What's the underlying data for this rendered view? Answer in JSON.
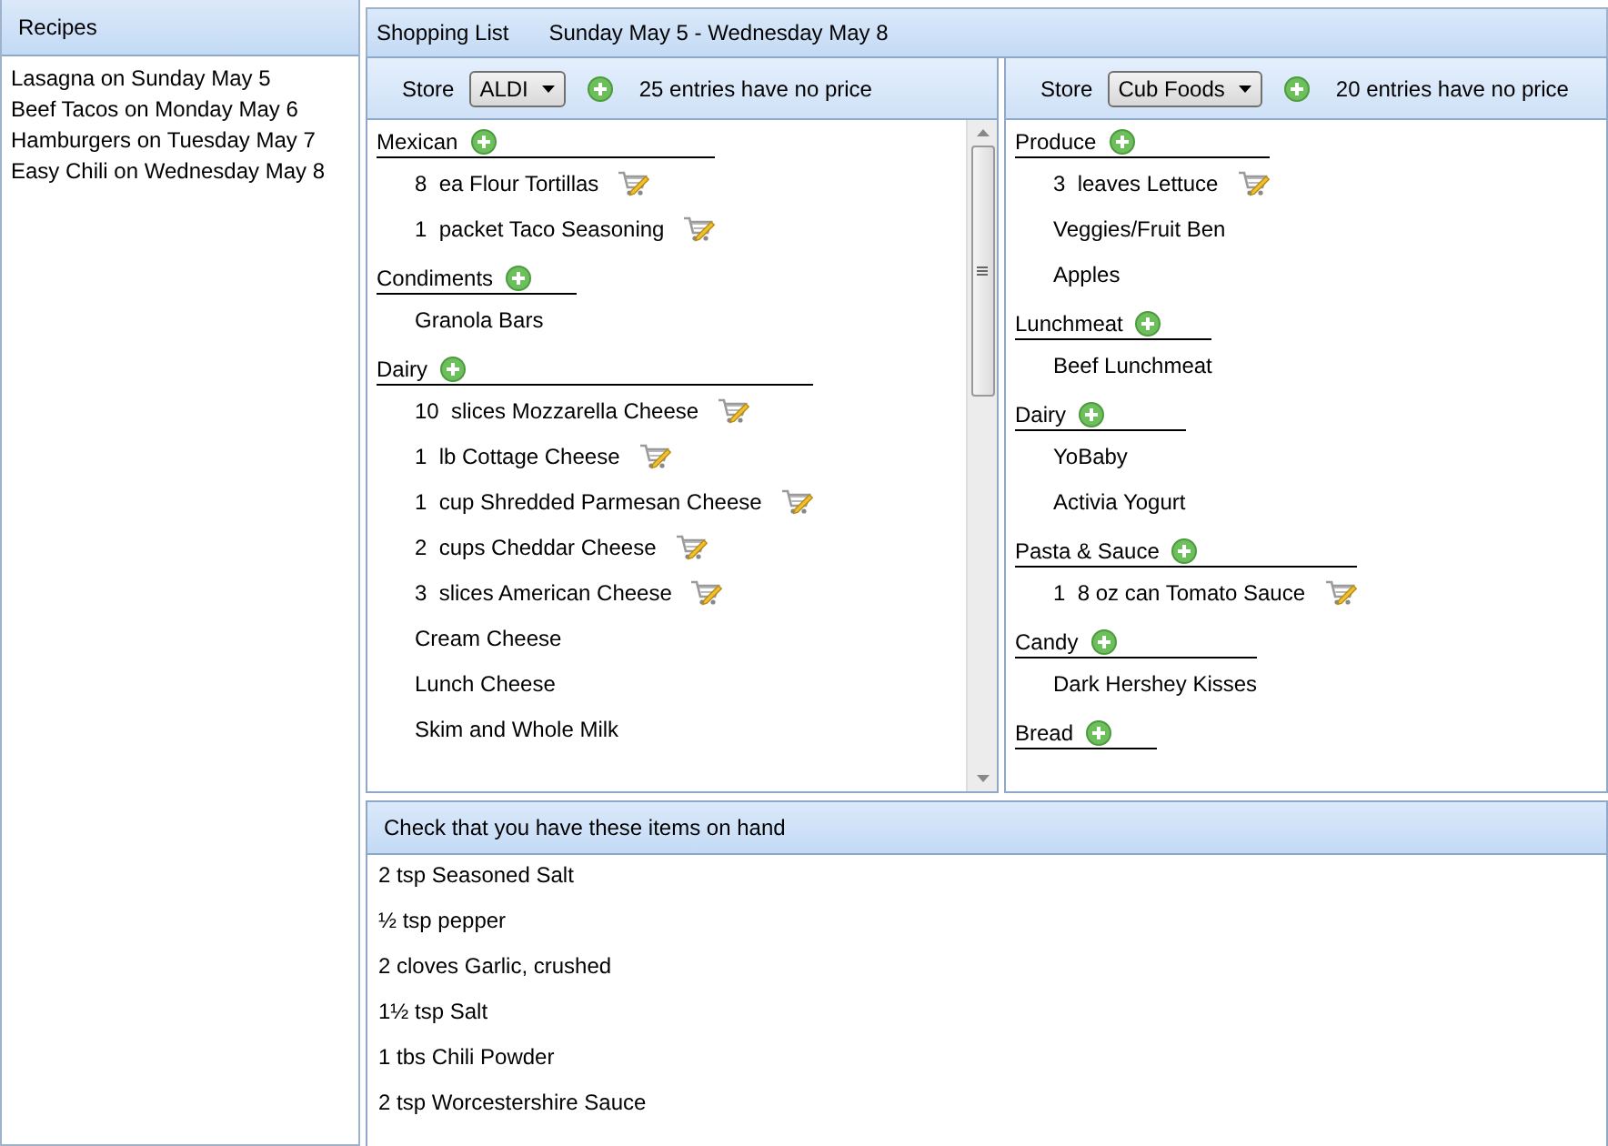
{
  "recipes_panel": {
    "title": "Recipes",
    "items": [
      {
        "label": "Lasagna on Sunday May 5"
      },
      {
        "label": "Beef Tacos on Monday May 6"
      },
      {
        "label": "Hamburgers on Tuesday May 7"
      },
      {
        "label": "Easy Chili on Wednesday May 8"
      }
    ]
  },
  "shopping_list": {
    "title": "Shopping List",
    "date_range": "Sunday May 5 - Wednesday May 8",
    "stores": [
      {
        "store_label": "Store",
        "store": "ALDI",
        "no_price_note": "25 entries have no price",
        "scrollbar": true,
        "categories": [
          {
            "name": "Mexican",
            "items": [
              {
                "text": "8  ea Flour Tortillas",
                "edit_icon": true
              },
              {
                "text": "1  packet Taco Seasoning",
                "edit_icon": true
              }
            ]
          },
          {
            "name": "Condiments",
            "items": [
              {
                "text": "Granola Bars",
                "edit_icon": false
              }
            ]
          },
          {
            "name": "Dairy",
            "items": [
              {
                "text": "10  slices Mozzarella Cheese",
                "edit_icon": true
              },
              {
                "text": "1  lb Cottage Cheese",
                "edit_icon": true
              },
              {
                "text": "1  cup Shredded Parmesan Cheese",
                "edit_icon": true
              },
              {
                "text": "2  cups Cheddar Cheese",
                "edit_icon": true
              },
              {
                "text": "3  slices American Cheese",
                "edit_icon": true
              },
              {
                "text": "Cream Cheese",
                "edit_icon": false
              },
              {
                "text": "Lunch Cheese",
                "edit_icon": false
              },
              {
                "text": "Skim and Whole Milk",
                "edit_icon": false
              }
            ]
          }
        ]
      },
      {
        "store_label": "Store",
        "store": "Cub Foods",
        "no_price_note": "20 entries have no price",
        "scrollbar": false,
        "categories": [
          {
            "name": "Produce",
            "items": [
              {
                "text": "3  leaves Lettuce",
                "edit_icon": true
              },
              {
                "text": "Veggies/Fruit Ben",
                "edit_icon": false
              },
              {
                "text": "Apples",
                "edit_icon": false
              }
            ]
          },
          {
            "name": "Lunchmeat",
            "items": [
              {
                "text": "Beef Lunchmeat",
                "edit_icon": false
              }
            ]
          },
          {
            "name": "Dairy",
            "items": [
              {
                "text": "YoBaby",
                "edit_icon": false
              },
              {
                "text": "Activia Yogurt",
                "edit_icon": false
              }
            ]
          },
          {
            "name": "Pasta & Sauce",
            "items": [
              {
                "text": "1  8 oz can Tomato Sauce",
                "edit_icon": true
              }
            ]
          },
          {
            "name": "Candy",
            "items": [
              {
                "text": "Dark Hershey Kisses",
                "edit_icon": false
              }
            ]
          },
          {
            "name": "Bread"
          }
        ]
      }
    ]
  },
  "on_hand": {
    "title": "Check that you have these items on hand",
    "items": [
      {
        "text": "2 tsp Seasoned Salt"
      },
      {
        "text": "½ tsp pepper"
      },
      {
        "text": "2 cloves Garlic, crushed"
      },
      {
        "text": "1½ tsp Salt"
      },
      {
        "text": "1 tbs Chili Powder"
      },
      {
        "text": "2 tsp Worcestershire Sauce"
      }
    ]
  }
}
